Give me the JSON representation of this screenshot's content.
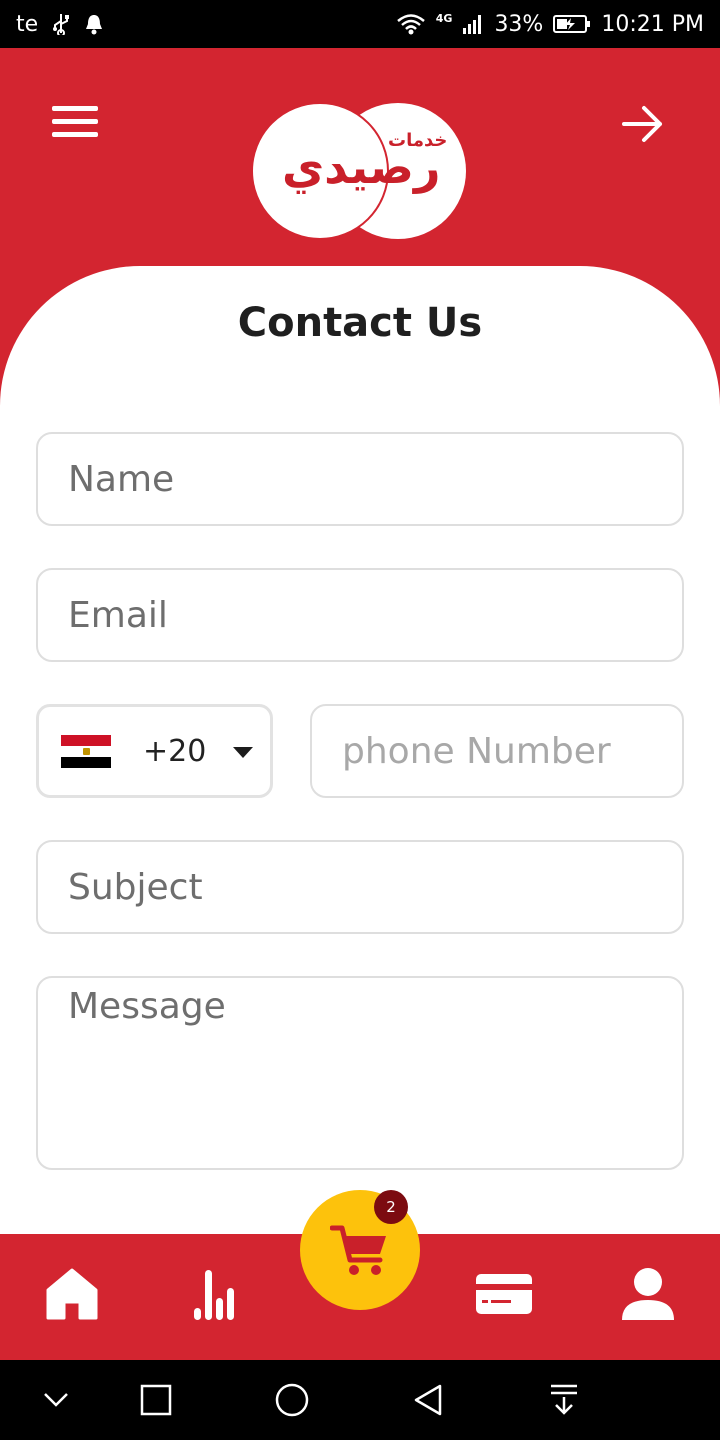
{
  "status_bar": {
    "carrier": "te",
    "network": "4G",
    "battery": "33%",
    "time": "10:21 PM",
    "icons": [
      "usb-icon",
      "notification-bell-icon",
      "wifi-icon",
      "signal-icon",
      "battery-charging-icon"
    ]
  },
  "header": {
    "logo_text_main": "رصيدي",
    "logo_text_small": "خدمات",
    "background_color": "#d32530",
    "icons": {
      "menu": "hamburger-menu-icon",
      "forward": "arrow-right-icon"
    }
  },
  "page": {
    "title": "Contact Us"
  },
  "form": {
    "name_placeholder": "Name",
    "email_placeholder": "Email",
    "country_code": "+20",
    "country_flag": "egypt-flag-icon",
    "phone_placeholder": "phone Number",
    "subject_placeholder": "Subject",
    "message_placeholder": "Message"
  },
  "bottom_nav": {
    "items": [
      {
        "name": "home",
        "icon": "home-icon"
      },
      {
        "name": "stats",
        "icon": "bar-chart-icon"
      },
      {
        "name": "cart",
        "icon": "shopping-cart-icon"
      },
      {
        "name": "cards",
        "icon": "credit-card-icon"
      },
      {
        "name": "profile",
        "icon": "user-icon"
      }
    ],
    "cart_badge": "2",
    "accent_color": "#fdc20c",
    "badge_color": "#7c0b10"
  },
  "system_nav": {
    "icons": [
      "chevron-down-icon",
      "recents-square-icon",
      "home-circle-icon",
      "back-triangle-icon",
      "notification-pull-icon"
    ]
  }
}
